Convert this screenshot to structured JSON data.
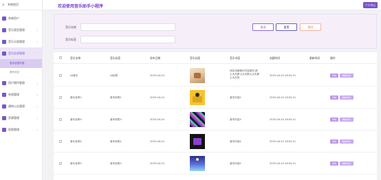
{
  "sidebar": {
    "brand": "系统首页",
    "items": [
      {
        "label": "系统用户"
      },
      {
        "label": "音乐类型管理"
      },
      {
        "label": "音乐分类管理"
      },
      {
        "label": "音乐信息管理",
        "submenu": [
          "音乐信息列表",
          "音乐评论"
        ]
      },
      {
        "label": "用户操作管理"
      },
      {
        "label": "系统管理"
      },
      {
        "label": "通知公告管理"
      },
      {
        "label": "资源管理"
      },
      {
        "label": "权限管理"
      }
    ]
  },
  "header": {
    "title": "欢迎使用音乐助手小程序",
    "user_button": "个人中心"
  },
  "search": {
    "name_label": "音乐名称",
    "name_placeholder": "",
    "tag_label": "音乐标签",
    "tag_placeholder": "",
    "search_button": "查询",
    "reset_button": "重置",
    "delete_button": "删除"
  },
  "table": {
    "columns": [
      "音乐名称",
      "音乐标签",
      "发布日期",
      "音乐封面",
      "音乐内容",
      "创建时间",
      "更新时间",
      "操作"
    ],
    "action_detail": "详情",
    "action_delete": "删除评论",
    "rows": [
      {
        "name": "sd音乐",
        "tag": "sd标签",
        "date": "2025-04-24",
        "content": "阔达详细音乐内容描写,那士大夫那士大夫那士大夫那士大夫的",
        "created": "2025-04-24 16:02:21",
        "cover": "cover-1"
      },
      {
        "name": "音乐名称2",
        "tag": "音乐标签2",
        "date": "2025-04-24",
        "content": "音乐内容2",
        "created": "2025-04-24 16:02:21",
        "cover": "cover-2"
      },
      {
        "name": "音乐名称3",
        "tag": "音乐标签3",
        "date": "2025-04-24",
        "content": "音乐内容3",
        "created": "2025-04-24 16:02:21",
        "cover": "cover-3"
      },
      {
        "name": "音乐名称4",
        "tag": "音乐标签4",
        "date": "2025-04-24",
        "content": "音乐内容4",
        "created": "2025-04-24 16:02:21",
        "cover": "cover-4"
      },
      {
        "name": "音乐名称5",
        "tag": "音乐标签5",
        "date": "2025-04-24",
        "content": "音乐内容5",
        "created": "2025-04-24 16:02:21",
        "cover": "cover-5"
      }
    ]
  },
  "colors": {
    "accent": "#7a56c8",
    "title": "#7a3fd1",
    "panel": "#f6eef9"
  }
}
